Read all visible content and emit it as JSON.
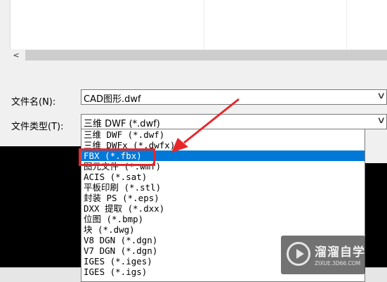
{
  "dialog": {
    "filename_label": "文件名(N):",
    "filename_value": "CAD图形.dwf",
    "filetype_label": "文件类型(T):",
    "filetype_value": "三维 DWF (*.dwf)"
  },
  "filetype_options": [
    {
      "label": "三维 DWF (*.dwf)"
    },
    {
      "label": "三维 DWFx (*.dwfx)"
    },
    {
      "label": "FBX (*.fbx)",
      "selected": true
    },
    {
      "label": "图元文件 (*.wmf)"
    },
    {
      "label": "ACIS (*.sat)"
    },
    {
      "label": "平板印刷 (*.stl)"
    },
    {
      "label": "封装 PS (*.eps)"
    },
    {
      "label": "DXX 提取 (*.dxx)"
    },
    {
      "label": "位图 (*.bmp)"
    },
    {
      "label": "块 (*.dwg)"
    },
    {
      "label": "V8 DGN (*.dgn)"
    },
    {
      "label": "V7 DGN (*.dgn)"
    },
    {
      "label": "IGES (*.iges)"
    },
    {
      "label": "IGES (*.igs)"
    }
  ],
  "annotation": {
    "highlight_color": "#e8262a",
    "arrow_color": "#e8262a"
  },
  "watermark": {
    "name": "溜溜自学",
    "url": "ZIXUE.3D66.COM"
  },
  "colors": {
    "selection": "#0078d7"
  }
}
